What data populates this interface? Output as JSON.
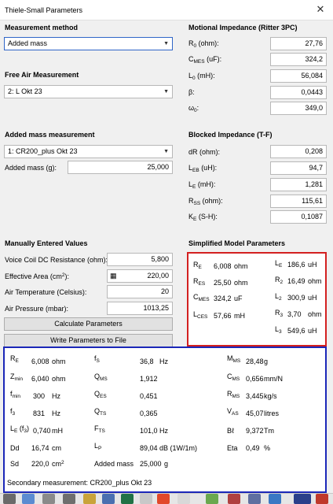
{
  "window": {
    "title": "Thiele-Small Parameters"
  },
  "measurement_method": {
    "heading": "Measurement method",
    "selected": "Added mass"
  },
  "free_air": {
    "heading": "Free Air Measurement",
    "selected": "2: L Okt 23"
  },
  "added_mass": {
    "heading": "Added mass measurement",
    "selected": "1: CR200_plus Okt 23",
    "mass_label": "Added mass (g):",
    "mass_value": "25,000"
  },
  "manual": {
    "heading": "Manually Entered Values",
    "vc_label": "Voice Coil DC Resistance (ohm):",
    "vc_value": "5,800",
    "area_label": "Effective Area (cm",
    "area_value": "220,00",
    "temp_label": "Air Temperature (Celsius):",
    "temp_value": "20",
    "press_label": "Air Pressure (mbar):",
    "press_value": "1013,25",
    "calc_button": "Calculate Parameters",
    "write_button": "Write Parameters to File"
  },
  "motional": {
    "heading": "Motional Impedance (Ritter 3PC)",
    "r0": "27,76",
    "cmes": "324,2",
    "l0": "56,084",
    "beta": "0,0443",
    "w0": "349,0",
    "beta_label": "β:",
    "w0_label": "ω"
  },
  "blocked": {
    "heading": "Blocked Impedance (T-F)",
    "dr": "0,208",
    "leb": "94,7",
    "le": "1,281",
    "rss": "115,61",
    "ke": "0,1087"
  },
  "simplified": {
    "heading": "Simplified Model Parameters",
    "re": "6,008",
    "re_u": "ohm",
    "res": "25,50",
    "res_u": "ohm",
    "cmes": "324,2",
    "cmes_u": "uF",
    "lces": "57,66",
    "lces_u": "mH",
    "le": "186,6",
    "le_u": "uH",
    "r2": "16,49",
    "r2_u": "ohm",
    "l2": "300,9",
    "l2_u": "uH",
    "r3": "3,70",
    "r3_u": "ohm",
    "l3": "549,6",
    "l3_u": "uH"
  },
  "results": {
    "re": "6,008",
    "re_u": "ohm",
    "fs": "36,8",
    "fs_u": "Hz",
    "mms": "28,48",
    "mms_u": "g",
    "zmin": "6,040",
    "zmin_u": "ohm",
    "qms": "1,912",
    "cms": "0,656",
    "cms_u": "mm/N",
    "fmin": "300",
    "fmin_u": "Hz",
    "qes": "0,451",
    "rms": "3,445",
    "rms_u": "kg/s",
    "f3": "831",
    "f3_u": "Hz",
    "qts": "0,365",
    "vas": "45,07",
    "vas_u": "litres",
    "lef3": "0,740",
    "lef3_u": "mH",
    "fts": "101,0",
    "fts_u": "Hz",
    "bl": "9,372",
    "bl_u": "Tm",
    "dd": "16,74",
    "dd_u": "cm",
    "lp": "89,04",
    "lp_u": "dB (1W/1m)",
    "eta": "0,49",
    "eta_u": "%",
    "sd": "220,0",
    "sd_u": "cm",
    "am_label": "Added mass",
    "am": "25,000",
    "am_u": "g",
    "secondary": "Secondary measurement: CR200_plus Okt 23"
  }
}
